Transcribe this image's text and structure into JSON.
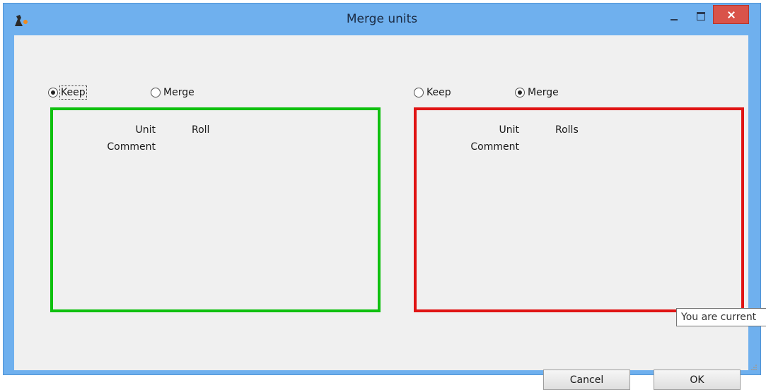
{
  "window": {
    "title": "Merge units",
    "accent_color": "#6fb0ee",
    "close_color": "#d9534a",
    "app_icon": "app-logo-icon"
  },
  "left_panel": {
    "keep_label": "Keep",
    "merge_label": "Merge",
    "selected": "Keep",
    "border_color": "#0fc00f",
    "unit_label": "Unit",
    "value": "Roll",
    "comment_label": "Comment"
  },
  "right_panel": {
    "keep_label": "Keep",
    "merge_label": "Merge",
    "selected": "Merge",
    "border_color": "#e01414",
    "unit_label": "Unit",
    "value": "Rolls",
    "comment_label": "Comment"
  },
  "tooltip": {
    "text": "You are current"
  },
  "buttons": {
    "cancel": "Cancel",
    "ok": "OK"
  }
}
